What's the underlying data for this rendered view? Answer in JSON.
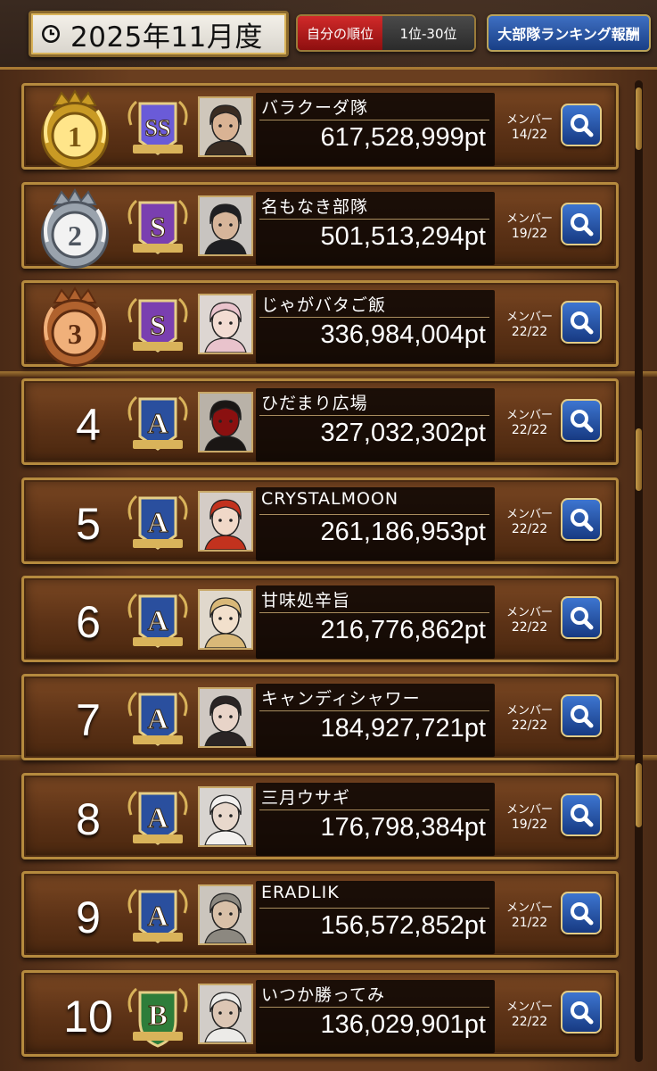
{
  "header": {
    "month_label": "2025年11月度",
    "my_rank_label": "自分の順位",
    "range_label": "1位-30位",
    "reward_label": "大部隊ランキング報酬"
  },
  "members_label": "メンバー",
  "colors": {
    "gold": "#d9b35a",
    "red_button": "#c41e1e",
    "blue_button": "#2a5bb0",
    "grade_ss": "#6a5bd8",
    "grade_s": "#7a3fb0",
    "grade_a": "#2a4f9e",
    "grade_b": "#2e7d3a"
  },
  "rows": [
    {
      "rank": "1",
      "medal": "gold",
      "grade": "SS",
      "team": "バラクーダ隊",
      "points": "617,528,999pt",
      "members": "14/22",
      "avatar": "bearded-man"
    },
    {
      "rank": "2",
      "medal": "silver",
      "grade": "S",
      "team": "名もなき部隊",
      "points": "501,513,294pt",
      "members": "19/22",
      "avatar": "officer"
    },
    {
      "rank": "3",
      "medal": "bronze",
      "grade": "S",
      "team": "じゃがバタご飯",
      "points": "336,984,004pt",
      "members": "22/22",
      "avatar": "pink-hair-girl"
    },
    {
      "rank": "4",
      "medal": "",
      "grade": "A",
      "team": "ひだまり広場",
      "points": "327,032,302pt",
      "members": "22/22",
      "avatar": "masked-figure"
    },
    {
      "rank": "5",
      "medal": "",
      "grade": "A",
      "team": "CRYSTALMOON",
      "points": "261,186,953pt",
      "members": "22/22",
      "avatar": "red-hair-girl"
    },
    {
      "rank": "6",
      "medal": "",
      "grade": "A",
      "team": "甘味処辛旨",
      "points": "216,776,862pt",
      "members": "22/22",
      "avatar": "blonde-girl"
    },
    {
      "rank": "7",
      "medal": "",
      "grade": "A",
      "team": "キャンディシャワー",
      "points": "184,927,721pt",
      "members": "22/22",
      "avatar": "dark-hair-woman"
    },
    {
      "rank": "8",
      "medal": "",
      "grade": "A",
      "team": "三月ウサギ",
      "points": "176,798,384pt",
      "members": "19/22",
      "avatar": "white-hair-girl"
    },
    {
      "rank": "9",
      "medal": "",
      "grade": "A",
      "team": "ERADLIK",
      "points": "156,572,852pt",
      "members": "21/22",
      "avatar": "glasses-man"
    },
    {
      "rank": "10",
      "medal": "",
      "grade": "B",
      "team": "いつか勝ってみ",
      "points": "136,029,901pt",
      "members": "22/22",
      "avatar": "white-hair-man"
    }
  ]
}
